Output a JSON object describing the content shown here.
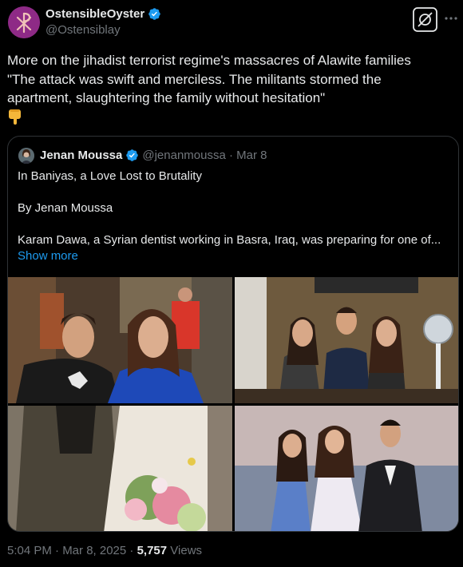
{
  "author": {
    "name": "OstensibleOyster",
    "handle": "@Ostensiblay",
    "avatar_icon": "chi-rho-icon",
    "accent": "#8e2a86"
  },
  "tweet": {
    "line1": "More on the jihadist terrorist regime's massacres of Alawite families",
    "line2": "\"The attack was swift and merciless. The militants stormed the",
    "line3": "apartment, slaughtering the family without hesitation\"",
    "emoji_icon": "pointing-down-icon"
  },
  "quote": {
    "name": "Jenan Moussa",
    "meta": "@jenanmoussa · Mar 8",
    "title": "In Baniyas, a Love Lost to Brutality",
    "byline": "By Jenan Moussa",
    "excerpt": "Karam Dawa, a Syrian dentist working in Basra, Iraq, was preparing for one of...",
    "show_more": "Show more"
  },
  "footer": {
    "time": "5:04 PM · Mar 8, 2025 · ",
    "views_count": "5,757",
    "views_label": " Views"
  },
  "colors": {
    "background": "#000000",
    "text": "#e7e9ea",
    "muted": "#71767b",
    "link": "#1d9bf0",
    "verified": "#1d9bf0"
  }
}
